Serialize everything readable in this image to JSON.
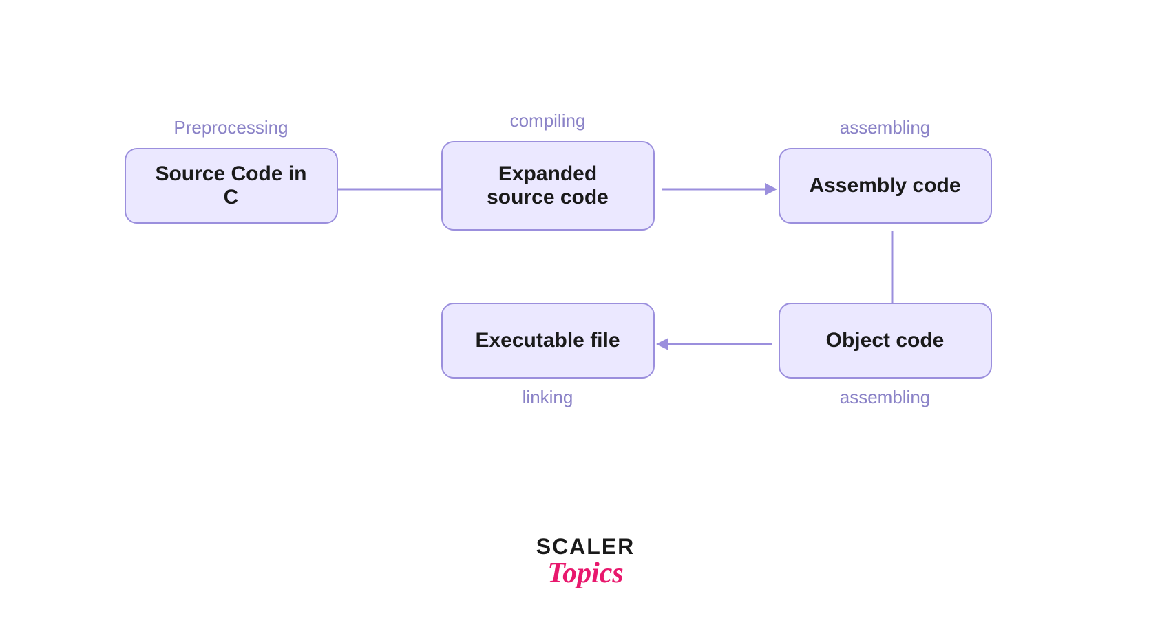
{
  "diagram": {
    "nodes": {
      "source": {
        "label": "Source Code in C",
        "stage": "Preprocessing"
      },
      "expanded": {
        "label": "Expanded source code",
        "stage": "compiling"
      },
      "assembly": {
        "label": "Assembly code",
        "stage": "assembling"
      },
      "object": {
        "label": "Object code",
        "stage": "assembling"
      },
      "executable": {
        "label": "Executable file",
        "stage": "linking"
      }
    },
    "colors": {
      "node_bg": "#ebe8ff",
      "node_border": "#9b8fdd",
      "arrow": "#9b8fdd",
      "label": "#8a82c7",
      "text": "#1a1a1a"
    }
  },
  "logo": {
    "scaler": "SCALER",
    "topics": "Topics"
  }
}
